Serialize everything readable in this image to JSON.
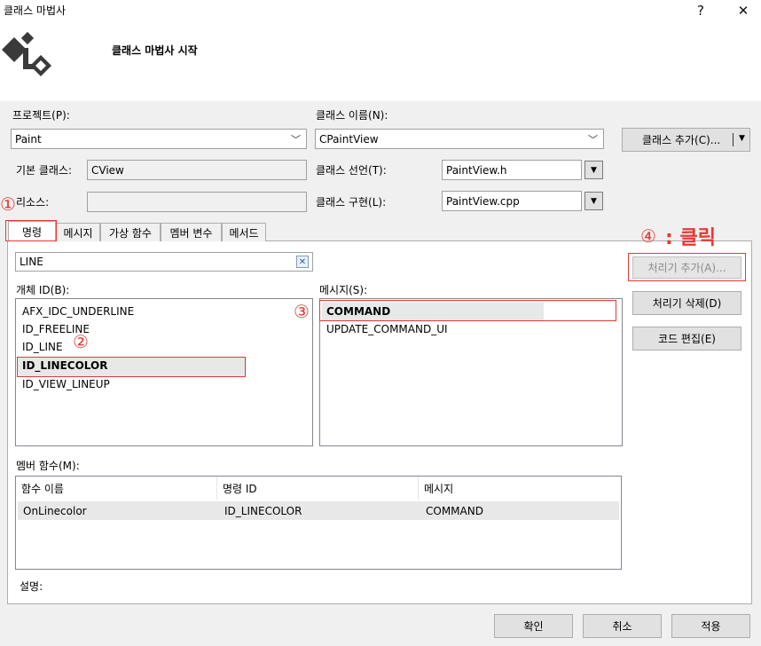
{
  "window": {
    "title": "클래스 마법사",
    "help": "?",
    "close": "✕"
  },
  "header": {
    "title": "클래스 마법사 시작"
  },
  "project": {
    "label": "프로젝트(P):",
    "value": "Paint"
  },
  "class_name": {
    "label": "클래스 이름(N):",
    "value": "CPaintView"
  },
  "add_class_button": "클래스 추가(C)...",
  "base_class": {
    "label": "기본 클래스:",
    "value": "CView"
  },
  "class_decl": {
    "label": "클래스 선언(T):",
    "value": "PaintView.h"
  },
  "resource": {
    "label": "리소스:",
    "value": ""
  },
  "class_impl": {
    "label": "클래스 구현(L):",
    "value": "PaintView.cpp"
  },
  "tabs": [
    {
      "label": "명령"
    },
    {
      "label": "메시지"
    },
    {
      "label": "가상 함수"
    },
    {
      "label": "멤버 변수"
    },
    {
      "label": "메서드"
    }
  ],
  "search": {
    "value": "LINE"
  },
  "object_ids": {
    "label": "개체 ID(B):",
    "items": [
      "AFX_IDC_UNDERLINE",
      "ID_FREELINE",
      "ID_LINE",
      "ID_LINECOLOR",
      "ID_VIEW_LINEUP"
    ]
  },
  "messages": {
    "label": "메시지(S):",
    "items": [
      "COMMAND",
      "UPDATE_COMMAND_UI"
    ]
  },
  "handler_buttons": {
    "add": "처리기 추가(A)...",
    "delete": "처리기 삭제(D)",
    "edit": "코드 편집(E)"
  },
  "member_functions": {
    "label": "멤버 함수(M):",
    "columns": [
      "함수 이름",
      "명령 ID",
      "메시지"
    ],
    "rows": [
      [
        "OnLinecolor",
        "ID_LINECOLOR",
        "COMMAND"
      ]
    ]
  },
  "description_label": "설명:",
  "footer": {
    "ok": "확인",
    "cancel": "취소",
    "apply": "적용"
  },
  "annotations": {
    "one": "①",
    "two": "②",
    "three": "③",
    "four": "④",
    "click": ": 클릭"
  },
  "colors": {
    "annotation": "#e53935",
    "selection": "#e8e8e8"
  },
  "icons": {
    "search_clear": "search-clear-icon",
    "wizard": "class-wizard-icon"
  }
}
